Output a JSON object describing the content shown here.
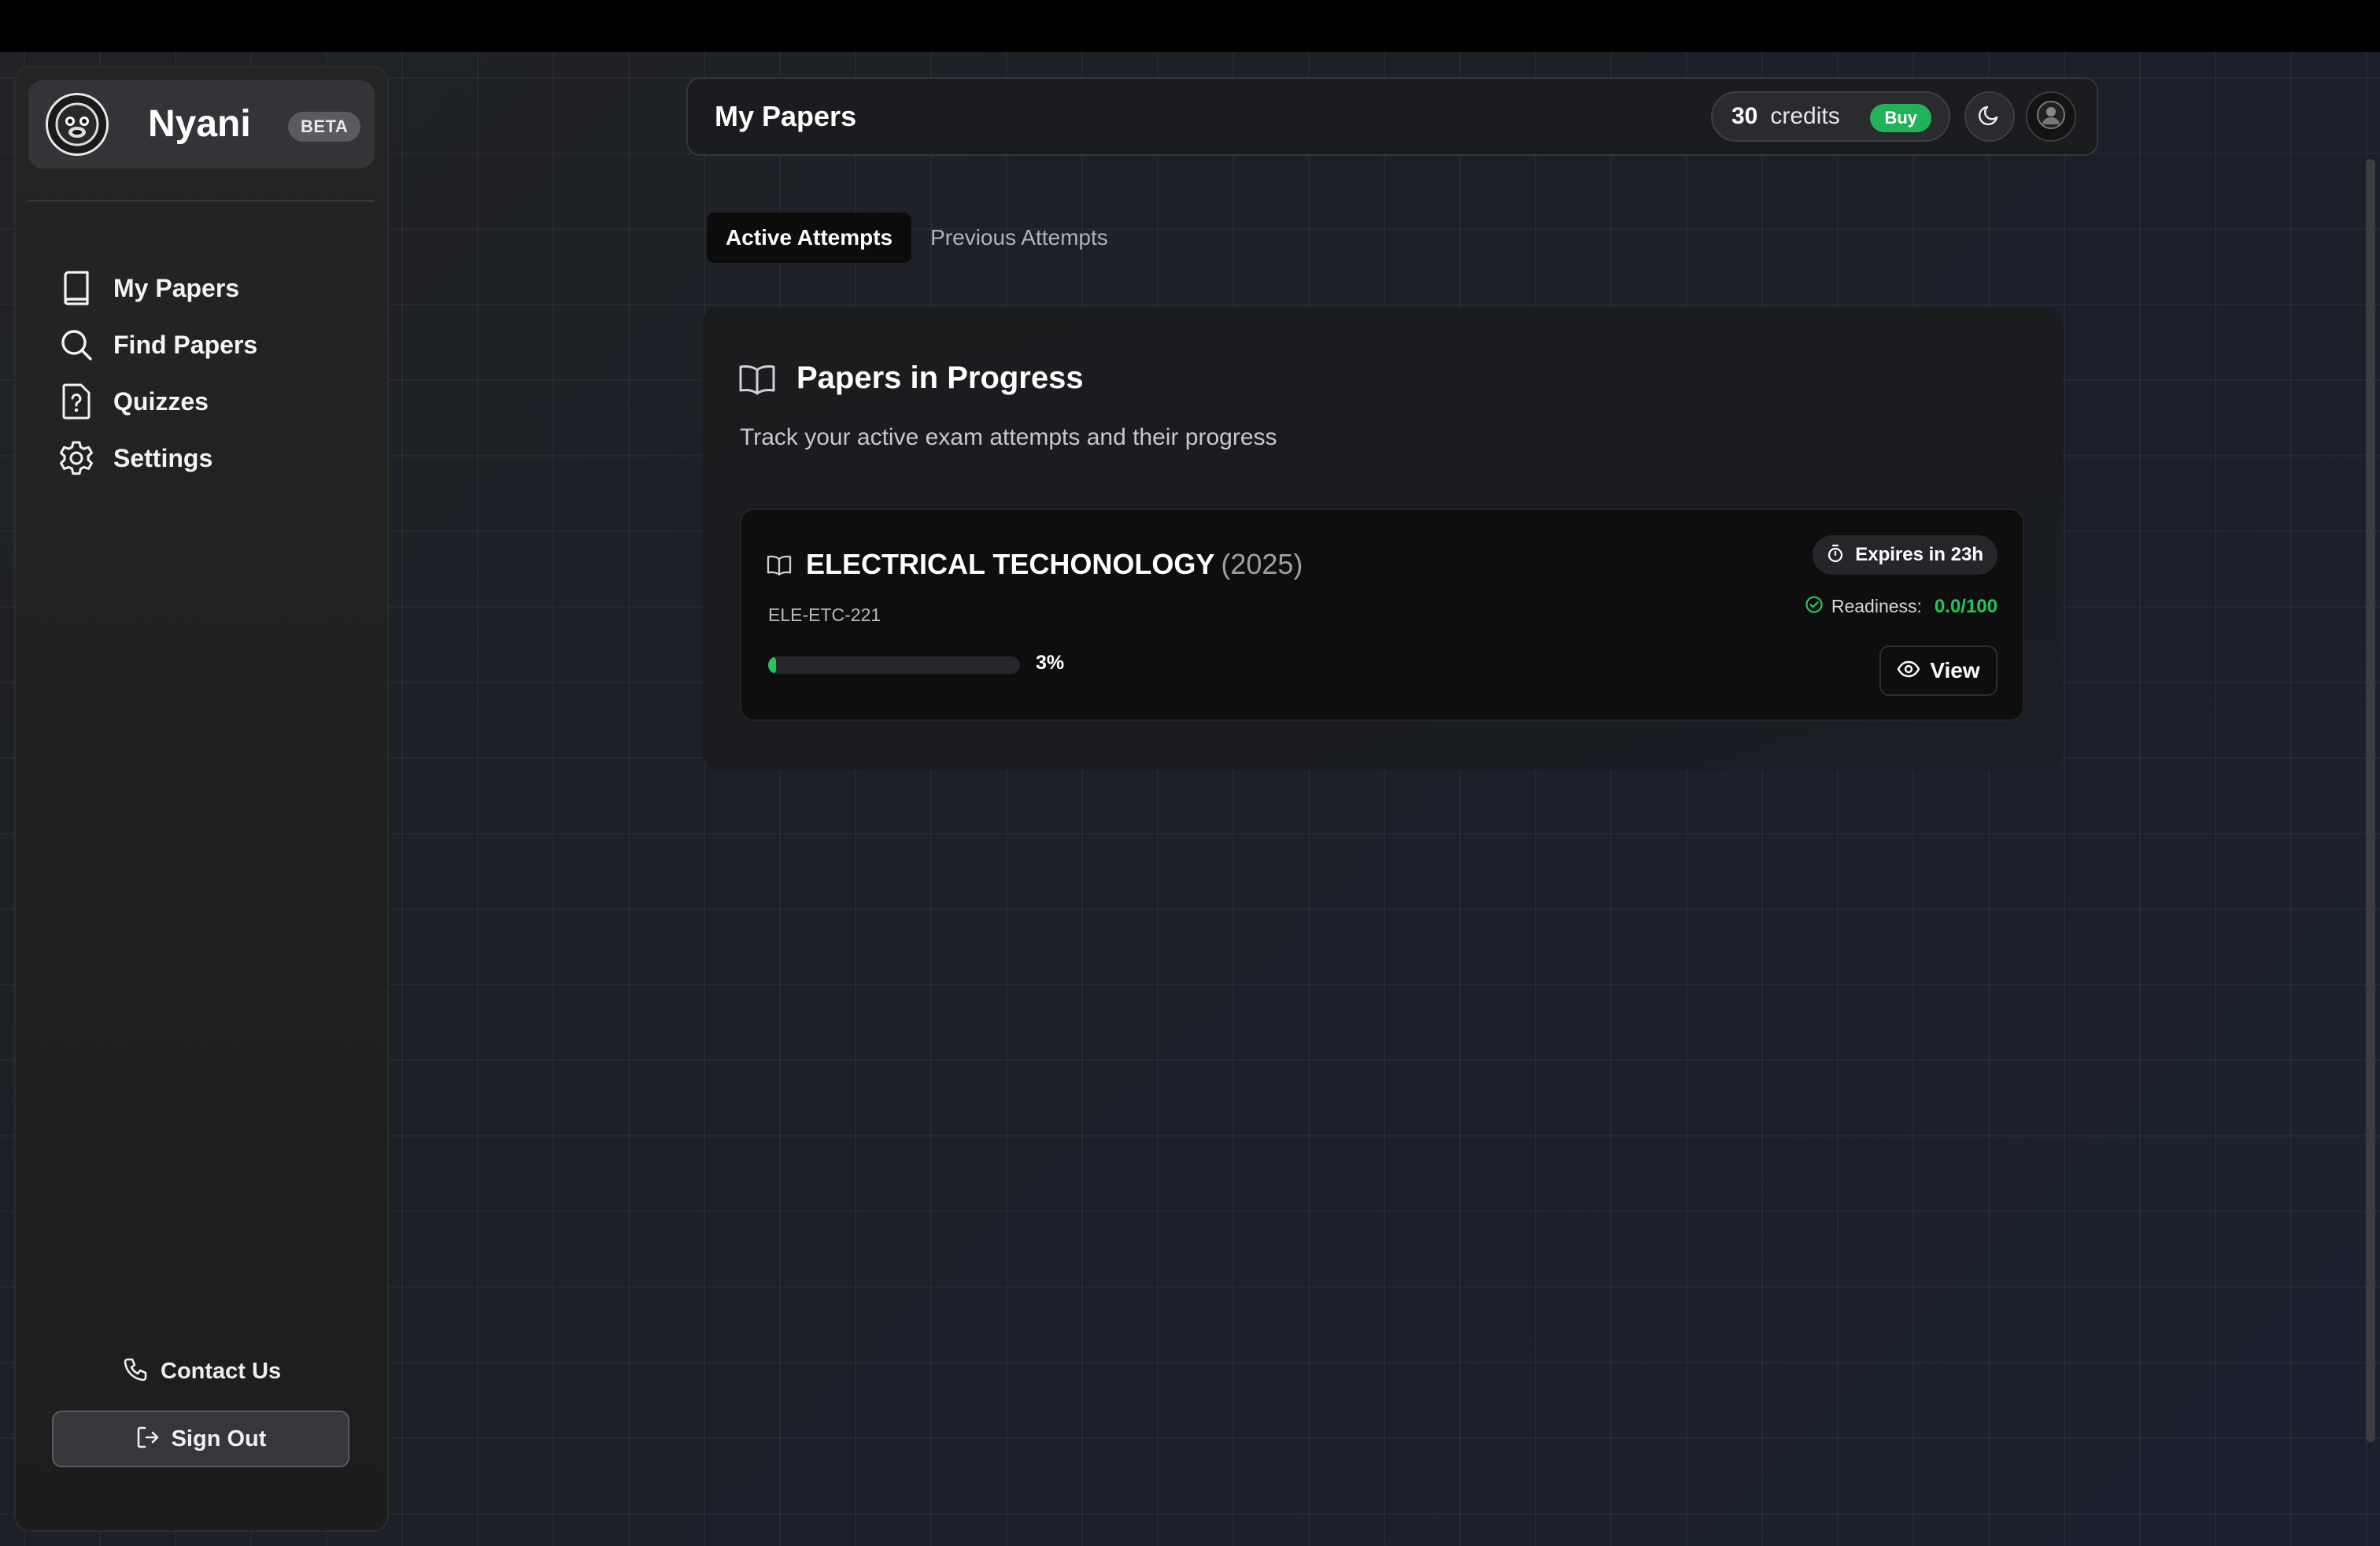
{
  "brand": {
    "name": "Nyani",
    "badge": "BETA"
  },
  "sidebar": {
    "items": [
      {
        "label": "My Papers",
        "icon": "book-icon"
      },
      {
        "label": "Find Papers",
        "icon": "search-icon"
      },
      {
        "label": "Quizzes",
        "icon": "quiz-icon"
      },
      {
        "label": "Settings",
        "icon": "gear-icon"
      }
    ],
    "contact_label": "Contact Us",
    "signout_label": "Sign Out"
  },
  "header": {
    "title": "My Papers",
    "credits_count": "30",
    "credits_word": "credits",
    "buy_label": "Buy"
  },
  "tabs": [
    {
      "label": "Active Attempts",
      "active": true
    },
    {
      "label": "Previous Attempts",
      "active": false
    }
  ],
  "panel": {
    "title": "Papers in Progress",
    "description": "Track your active exam attempts and their progress"
  },
  "paper": {
    "name": "ELECTRICAL TECHONOLOGY",
    "year": "(2025)",
    "code": "ELE-ETC-221",
    "progress": 3,
    "progress_label": "3%",
    "expires_label": "Expires in 23h",
    "readiness_label": "Readiness:",
    "readiness_value": "0.0/100",
    "view_label": "View"
  },
  "colors": {
    "accent_green": "#22c55e",
    "buy_green": "#22b35a",
    "background": "#1c1f26"
  }
}
